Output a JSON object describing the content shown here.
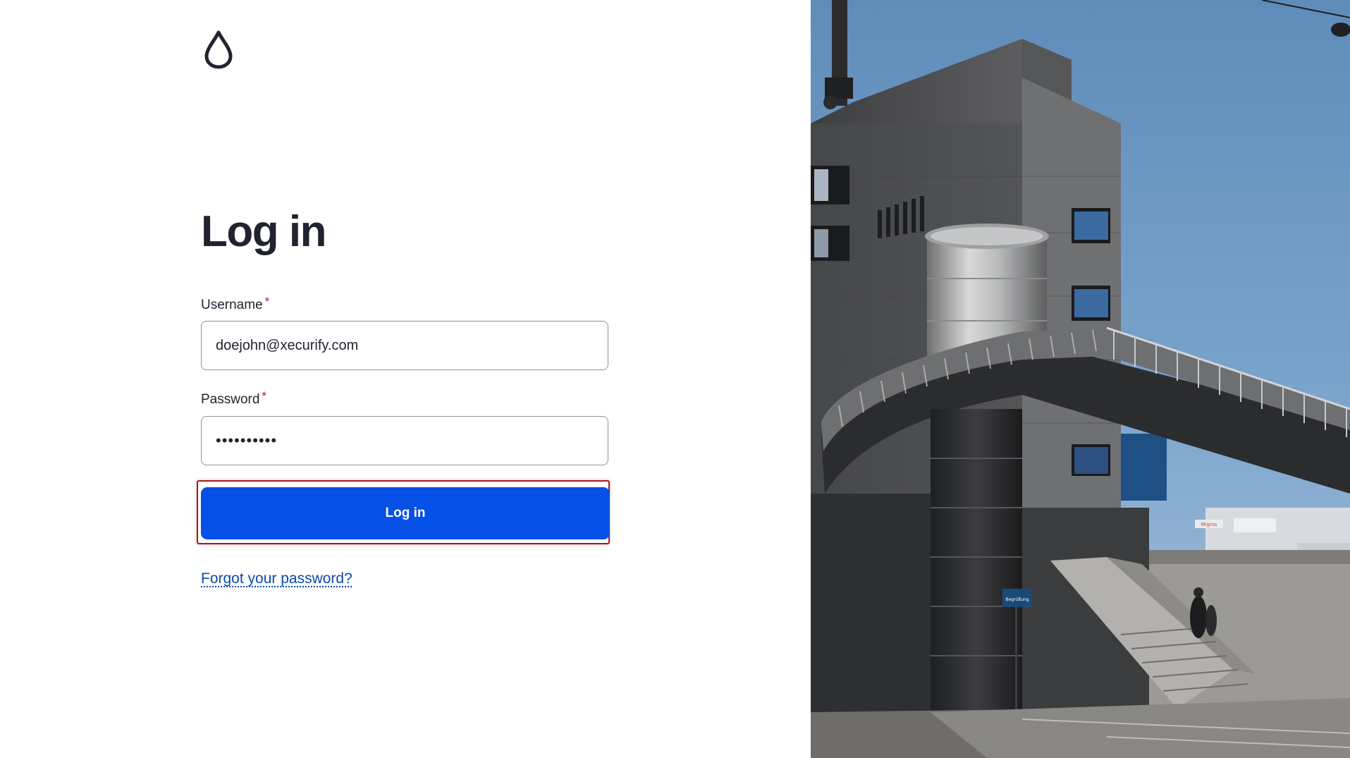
{
  "login": {
    "title": "Log in",
    "username_label": "Username",
    "username_required": "*",
    "username_value": "doejohn@xecurify.com",
    "password_label": "Password",
    "password_required": "*",
    "password_value": "••••••••••",
    "submit_label": "Log in",
    "forgot_link": "Forgot your password?"
  },
  "icons": {
    "logo": "drop-logo-icon"
  },
  "colors": {
    "primary_button": "#0550e6",
    "required_marker": "#c4161c",
    "link": "#0a4aa8",
    "focus_outline": "#b3121b",
    "text": "#222330"
  },
  "photo": {
    "sign_text": "Migros",
    "small_sign_text": "Begrüßung"
  }
}
